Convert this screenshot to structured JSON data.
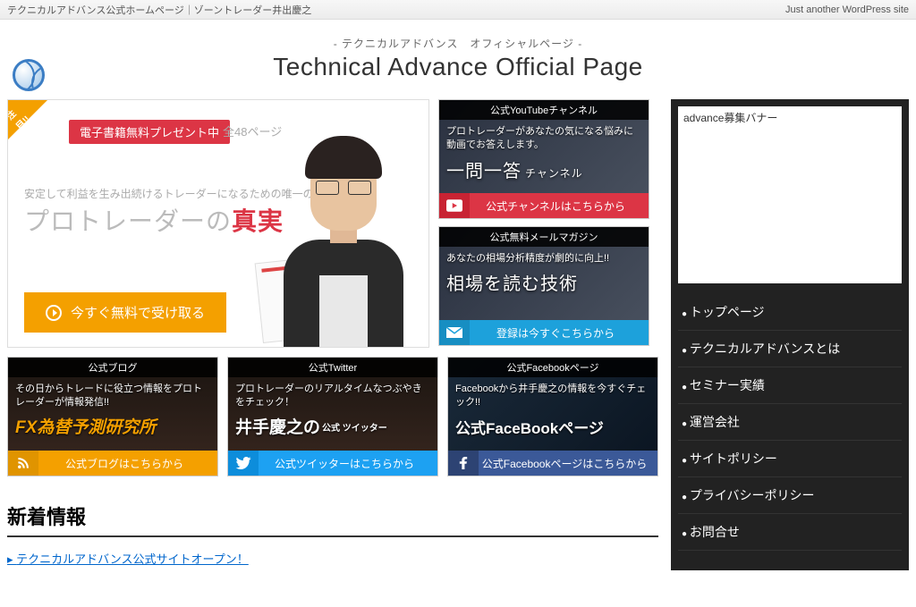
{
  "topbar": {
    "left": "テクニカルアドバンス公式ホームページ｜ゾーントレーダー井出慶之",
    "right": "Just another WordPress site"
  },
  "header": {
    "subtitle": "- テクニカルアドバンス　オフィシャルページ -",
    "title": "Technical Advance Official Page"
  },
  "hero": {
    "corner": "注目!!",
    "badge": "電子書籍無料プレゼント中",
    "pages": "全48ページ",
    "line1": "安定して利益を生み出続けるトレーダーになるための唯一の方法",
    "line2_a": "プロトレーダーの",
    "line2_b": "真実",
    "cta": "今すぐ無料で受け取る"
  },
  "cards": {
    "youtube": {
      "top": "公式YouTubeチャンネル",
      "text1": "プロトレーダーがあなたの気になる悩みに動画でお答えします。",
      "text2": "一問一答",
      "text2_sm": "チャンネル",
      "footer": "公式チャンネルはこちらから"
    },
    "mailmag": {
      "top": "公式無料メールマガジン",
      "text1": "あなたの相場分析精度が劇的に向上!!",
      "text2": "相場を読む技術",
      "footer": "登録は今すぐこちらから"
    },
    "blog": {
      "top": "公式ブログ",
      "text1": "その日からトレードに役立つ情報をプロトレーダーが情報発信!!",
      "text2": "FX為替予測研究所",
      "footer": "公式ブログはこちらから"
    },
    "twitter": {
      "top": "公式Twitter",
      "text1": "プロトレーダーのリアルタイムなつぶやきをチェック！",
      "text2_a": "井手慶之の",
      "text2_b": "公式\nツイッター",
      "footer": "公式ツイッターはこちらから"
    },
    "facebook": {
      "top": "公式Facebookページ",
      "text1": "Facebookから井手慶之の情報を今すぐチェック!!",
      "text2": "公式FaceBookページ",
      "footer": "公式Facebookページはこちらから"
    }
  },
  "news": {
    "title": "新着情報",
    "items": [
      "テクニカルアドバンス公式サイトオープン！"
    ]
  },
  "sidebar": {
    "banner": "advance募集バナー",
    "items": [
      "トップページ",
      "テクニカルアドバンスとは",
      "セミナー実績",
      "運営会社",
      "サイトポリシー",
      "プライバシーポリシー",
      "お問合せ"
    ]
  }
}
